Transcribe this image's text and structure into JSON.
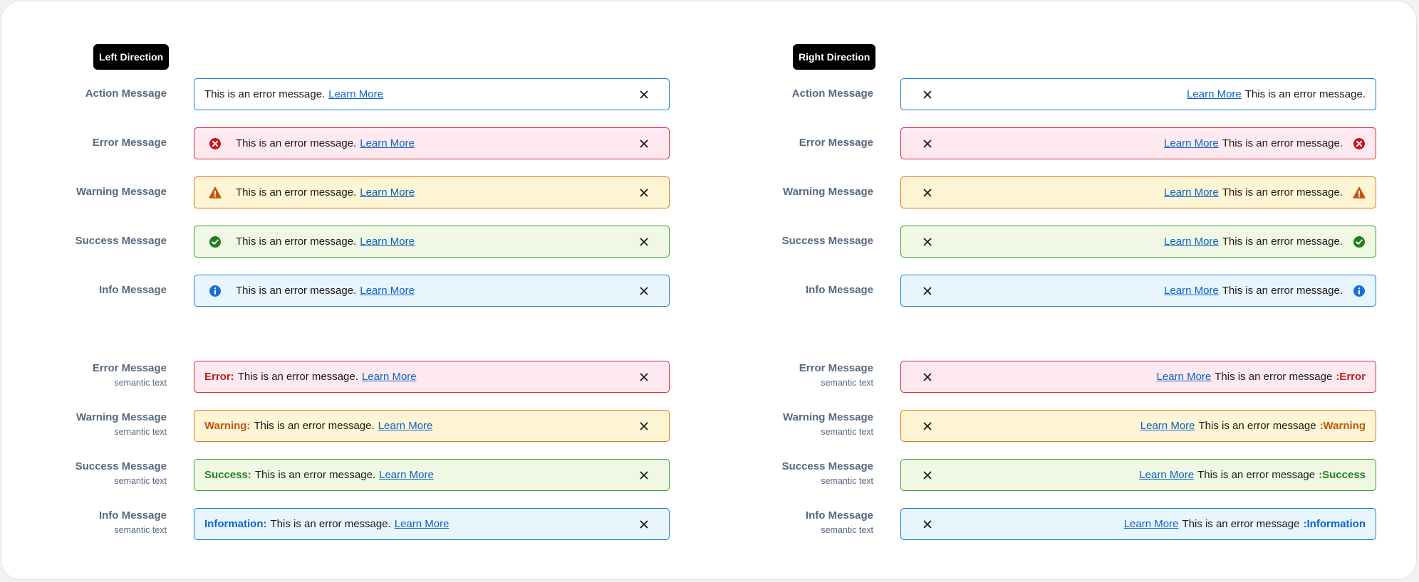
{
  "colors": {
    "error": "#d7262f",
    "warning": "#e1751a",
    "success": "#36a13a",
    "info": "#1579d6",
    "link": "#0b62c9"
  },
  "left_section": {
    "badge": "Left Direction",
    "rows": [
      {
        "label": "Action Message",
        "text": "This is an error message.",
        "link": "Learn More"
      },
      {
        "label": "Error Message",
        "text": "This is an error message.",
        "link": "Learn More",
        "icon": "error-circle-icon"
      },
      {
        "label": "Warning Message",
        "text": "This is an error message.",
        "link": "Learn More",
        "icon": "warning-triangle-icon"
      },
      {
        "label": "Success Message",
        "text": "This is an error message.",
        "link": "Learn More",
        "icon": "success-check-icon"
      },
      {
        "label": "Info Message",
        "text": "This is an error message.",
        "link": "Learn More",
        "icon": "info-circle-icon"
      }
    ],
    "semantic_rows": [
      {
        "label": "Error Message",
        "sublabel": "semantic text",
        "prefix": "Error:",
        "text": "This is an error message.",
        "link": "Learn More"
      },
      {
        "label": "Warning Message",
        "sublabel": "semantic text",
        "prefix": "Warning:",
        "text": "This is an error message.",
        "link": "Learn More"
      },
      {
        "label": "Success Message",
        "sublabel": "semantic text",
        "prefix": "Success:",
        "text": "This is an error message.",
        "link": "Learn More"
      },
      {
        "label": "Info Message",
        "sublabel": "semantic text",
        "prefix": "Information:",
        "text": "This is an error message.",
        "link": "Learn More"
      }
    ]
  },
  "right_section": {
    "badge": "Right Direction",
    "rows": [
      {
        "label": "Action Message",
        "text": "This is an error message.",
        "link": "Learn More"
      },
      {
        "label": "Error Message",
        "text": "This is an error message.",
        "link": "Learn More",
        "icon": "error-circle-icon"
      },
      {
        "label": "Warning Message",
        "text": "This is an error message.",
        "link": "Learn More",
        "icon": "warning-triangle-icon"
      },
      {
        "label": "Success Message",
        "text": "This is an error message.",
        "link": "Learn More",
        "icon": "success-check-icon"
      },
      {
        "label": "Info Message",
        "text": "This is an error message.",
        "link": "Learn More",
        "icon": "info-circle-icon"
      }
    ],
    "semantic_rows": [
      {
        "label": "Error Message",
        "sublabel": "semantic text",
        "prefix": ":Error",
        "text": "This is an error message",
        "link": "Learn More"
      },
      {
        "label": "Warning Message",
        "sublabel": "semantic text",
        "prefix": ":Warning",
        "text": "This is an error message",
        "link": "Learn More"
      },
      {
        "label": "Success Message",
        "sublabel": "semantic text",
        "prefix": ":Success",
        "text": "This is an error message",
        "link": "Learn More"
      },
      {
        "label": "Info Message",
        "sublabel": "semantic text",
        "prefix": ":Information",
        "text": "This is an error message",
        "link": "Learn More"
      }
    ]
  }
}
